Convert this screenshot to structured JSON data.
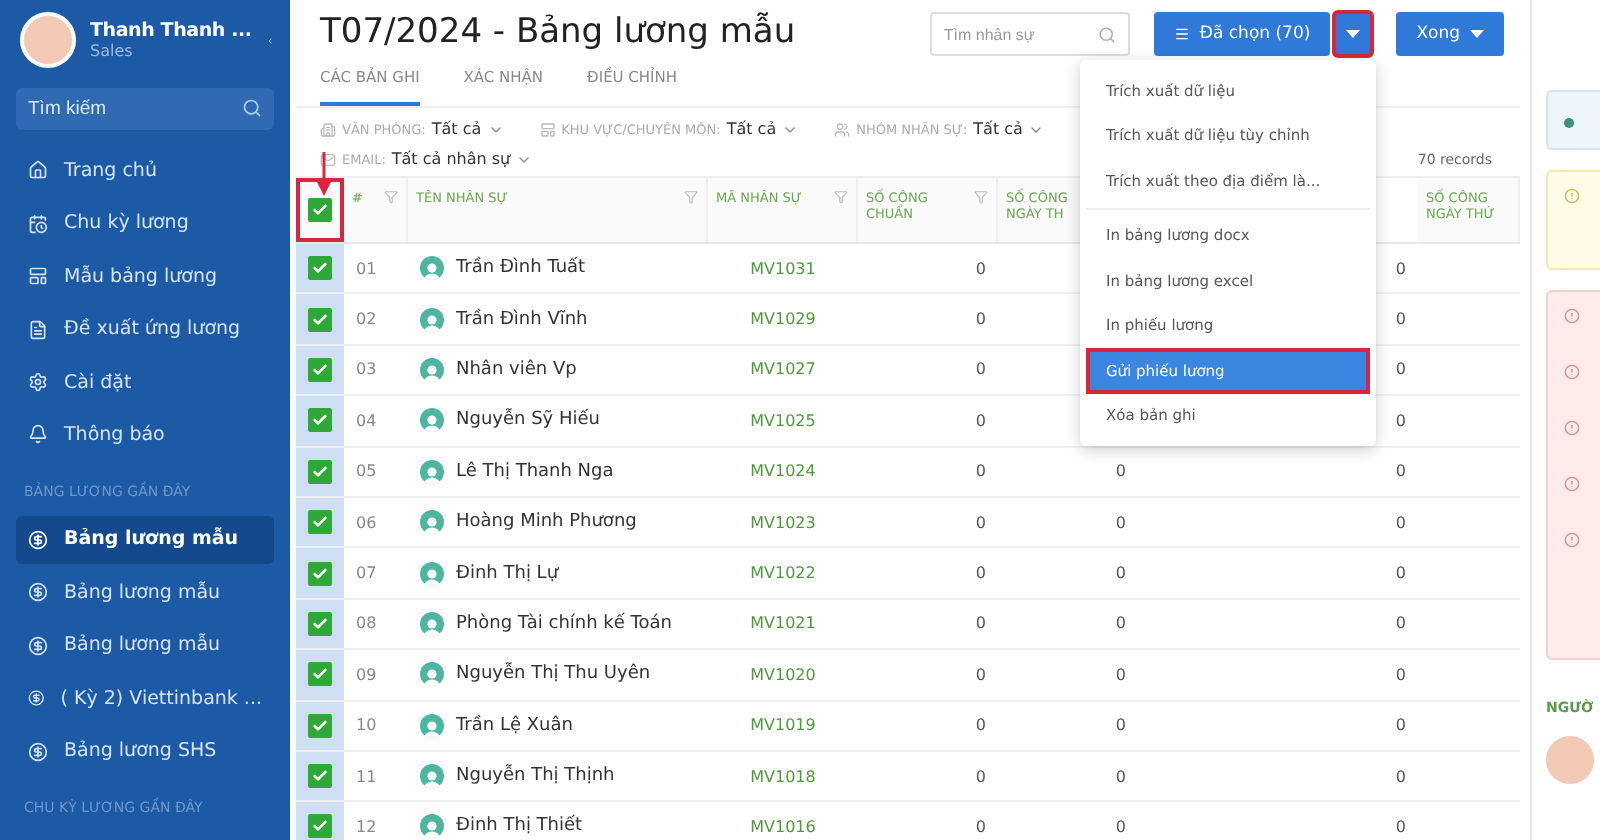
{
  "sidebar": {
    "user": {
      "name": "Thanh Thanh ...",
      "role": "Sales"
    },
    "search": {
      "placeholder": "Tìm kiếm"
    },
    "nav": [
      {
        "label": "Trang chủ",
        "selected": false
      },
      {
        "label": "Chu kỳ lương",
        "selected": false
      },
      {
        "label": "Mẫu bảng lương",
        "selected": false
      },
      {
        "label": "Đề xuất ứng lương",
        "selected": false
      },
      {
        "label": "Cài đặt",
        "selected": false
      },
      {
        "label": "Thông báo",
        "selected": false
      }
    ],
    "recent_title": "BẢNG LƯƠNG GẦN ĐÂY",
    "recent": [
      {
        "label": "Bảng lương mẫu",
        "selected": true
      },
      {
        "label": "Bảng lương mẫu",
        "selected": false
      },
      {
        "label": "Bảng lương mẫu",
        "selected": false
      },
      {
        "label": "( Kỳ 2) Viettinbank ...",
        "selected": false
      },
      {
        "label": "Bảng lương SHS",
        "selected": false
      }
    ],
    "cycles_title": "CHU KỲ LƯƠNG GẦN ĐÂY"
  },
  "title": "T07/2024 - Bảng lương mẫu",
  "tabs": [
    {
      "label": "CÁC BẢN GHI",
      "selected": true
    },
    {
      "label": "XÁC NHẬN",
      "selected": false
    },
    {
      "label": "ĐIỀU CHỈNH",
      "selected": false
    }
  ],
  "search": {
    "placeholder": "Tìm nhân sự"
  },
  "selected_button": "Đã chọn (70)",
  "caret_highlighted": true,
  "done_button": "Xong",
  "filters": [
    {
      "label": "VĂN PHÒNG:",
      "value": "Tất cả"
    },
    {
      "label": "KHU VỰC/CHUYÊN MÔN:",
      "value": "Tất cả"
    },
    {
      "label": "NHÓM NHÂN SỰ:",
      "value": "Tất cả"
    }
  ],
  "email_filter": {
    "label": "EMAIL:",
    "value": "Tất cả nhân sự"
  },
  "records": "70 records",
  "table": {
    "all_checked": true,
    "header_highlighted": true,
    "columns": [
      "#",
      "TÊN NHÂN SỰ",
      "MÃ NHÂN SỰ",
      "SỐ CÔNG CHUẨN",
      "SỐ CÔNG NGÀY TH",
      "SỐ CÔNG NGÀY THỨ"
    ],
    "rows": [
      {
        "checked": true,
        "num": "01",
        "name": "Trần Đình Tuất",
        "code": "MV1031",
        "c1": "0",
        "c3": "0"
      },
      {
        "checked": true,
        "num": "02",
        "name": "Trần Đình Vĩnh",
        "code": "MV1029",
        "c1": "0",
        "c3": "0"
      },
      {
        "checked": true,
        "num": "03",
        "name": "Nhân viên Vp",
        "code": "MV1027",
        "c1": "0",
        "c3": "0"
      },
      {
        "checked": true,
        "num": "04",
        "name": "Nguyễn Sỹ Hiếu",
        "code": "MV1025",
        "c1": "0",
        "c3": "0"
      },
      {
        "checked": true,
        "num": "05",
        "name": "Lê Thị Thanh Nga",
        "code": "MV1024",
        "c1": "0",
        "c2": "0",
        "c3": "0"
      },
      {
        "checked": true,
        "num": "06",
        "name": "Hoàng Minh Phương",
        "code": "MV1023",
        "c1": "0",
        "c2": "0",
        "c3": "0"
      },
      {
        "checked": true,
        "num": "07",
        "name": "Đinh Thị Lự",
        "code": "MV1022",
        "c1": "0",
        "c2": "0",
        "c3": "0"
      },
      {
        "checked": true,
        "num": "08",
        "name": "Phòng Tài chính kế Toán",
        "code": "MV1021",
        "c1": "0",
        "c2": "0",
        "c3": "0"
      },
      {
        "checked": true,
        "num": "09",
        "name": "Nguyễn Thị Thu Uyên",
        "code": "MV1020",
        "c1": "0",
        "c2": "0",
        "c3": "0"
      },
      {
        "checked": true,
        "num": "10",
        "name": "Trần Lệ Xuân",
        "code": "MV1019",
        "c1": "0",
        "c2": "0",
        "c3": "0"
      },
      {
        "checked": true,
        "num": "11",
        "name": "Nguyễn Thị Thịnh",
        "code": "MV1018",
        "c1": "0",
        "c2": "0",
        "c3": "0"
      },
      {
        "checked": true,
        "num": "12",
        "name": "Đinh Thị Thiết",
        "code": "MV1016",
        "c1": "0",
        "c2": "0",
        "c3": "0"
      }
    ]
  },
  "menu": [
    {
      "label": "Trích xuất dữ liệu",
      "selected": false,
      "divider": false
    },
    {
      "label": "Trích xuất dữ liệu tùy chỉnh",
      "selected": false,
      "divider": false
    },
    {
      "label": "Trích xuất theo địa điểm là...",
      "selected": false,
      "divider": true
    },
    {
      "label": "In bảng lương docx",
      "selected": false,
      "divider": false
    },
    {
      "label": "In bảng lương excel",
      "selected": false,
      "divider": false
    },
    {
      "label": "In phiếu lương",
      "selected": false,
      "divider": false
    },
    {
      "label": "Gửi phiếu lương",
      "selected": true,
      "divider": false
    },
    {
      "label": "Xóa bản ghi",
      "selected": false,
      "divider": false
    }
  ],
  "right_panel": {
    "section": "NGƯỜ"
  }
}
